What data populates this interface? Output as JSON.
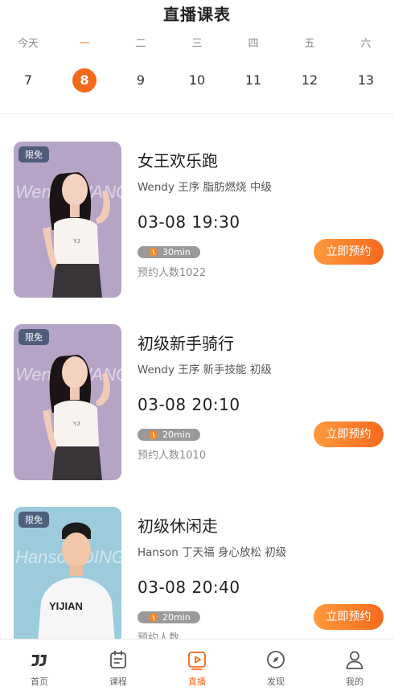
{
  "page": {
    "title": "直播课表"
  },
  "week": [
    {
      "label": "今天",
      "date": "7"
    },
    {
      "label": "一",
      "date": "8"
    },
    {
      "label": "二",
      "date": "9"
    },
    {
      "label": "三",
      "date": "10"
    },
    {
      "label": "四",
      "date": "11"
    },
    {
      "label": "五",
      "date": "12"
    },
    {
      "label": "六",
      "date": "13"
    }
  ],
  "selected_day_index": 1,
  "courses": [
    {
      "badge": "限免",
      "cover_watermark": "Wendy WANG",
      "name": "女王欢乐跑",
      "tags": "Wendy 王序 脂肪燃烧 中级",
      "time": "03-08 19:30",
      "duration": "30min",
      "count": "预约人数1022",
      "action": "立即预约",
      "cover_bg": "#b6a4c6"
    },
    {
      "badge": "限免",
      "cover_watermark": "Wendy WANG",
      "name": "初级新手骑行",
      "tags": "Wendy 王序 新手技能 初级",
      "time": "03-08 20:10",
      "duration": "20min",
      "count": "预约人数1010",
      "action": "立即预约",
      "cover_bg": "#b6a4c6"
    },
    {
      "badge": "限免",
      "cover_watermark": "Hanson DING",
      "name": "初级休闲走",
      "tags": "Hanson 丁天福 身心放松 初级",
      "time": "03-08 20:40",
      "duration": "20min",
      "count": "预约人数",
      "action": "立即预约",
      "cover_bg": "#9ccbdc"
    }
  ],
  "tabbar": [
    {
      "label": "首页",
      "icon": "home-logo-icon"
    },
    {
      "label": "课程",
      "icon": "calendar-icon"
    },
    {
      "label": "直播",
      "icon": "live-play-icon"
    },
    {
      "label": "发现",
      "icon": "compass-icon"
    },
    {
      "label": "我的",
      "icon": "user-icon"
    }
  ],
  "active_tab_index": 2,
  "colors": {
    "accent": "#f36a1c",
    "gradient_start": "#ff9a3e",
    "gradient_end": "#f56a1d",
    "badge_bg": "#4a5a78"
  }
}
